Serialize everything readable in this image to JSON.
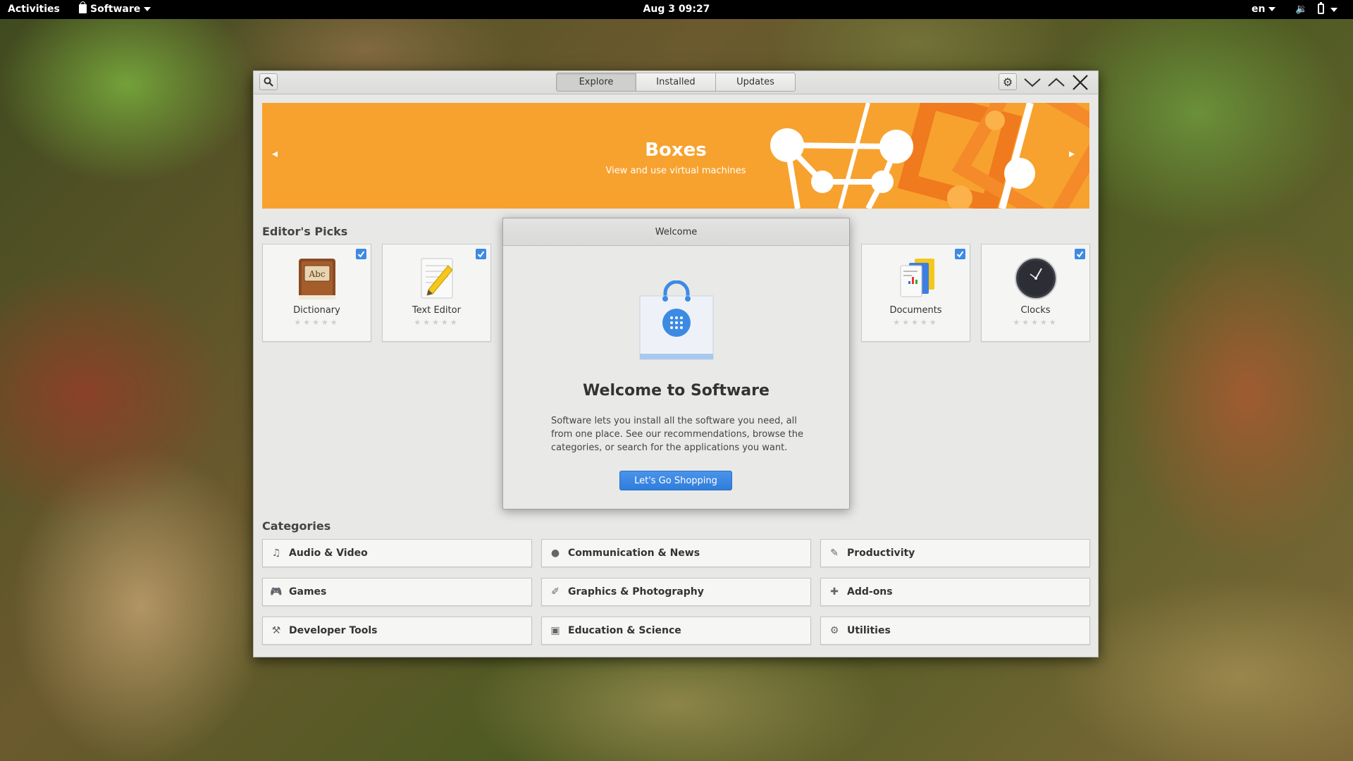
{
  "topbar": {
    "activities": "Activities",
    "app_menu": "Software",
    "clock": "Aug 3  09:27",
    "language": "en",
    "volume_glyph": "🔉"
  },
  "window": {
    "tabs": [
      {
        "label": "Explore",
        "active": true
      },
      {
        "label": "Installed",
        "active": false
      },
      {
        "label": "Updates",
        "active": false
      }
    ],
    "banner": {
      "title": "Boxes",
      "subtitle": "View and use virtual machines",
      "prev_glyph": "◂",
      "next_glyph": "▸",
      "color": "#f7a22e"
    },
    "editors_picks": {
      "title": "Editor's Picks",
      "items": [
        {
          "name": "Dictionary",
          "icon": "dictionary-icon",
          "stars": "★★★★★"
        },
        {
          "name": "Text Editor",
          "icon": "text-editor-icon",
          "stars": "★★★★★"
        },
        {
          "name": "Documents",
          "icon": "documents-icon",
          "stars": "★★★★★"
        },
        {
          "name": "Clocks",
          "icon": "clocks-icon",
          "stars": "★★★★★"
        }
      ]
    },
    "categories": {
      "title": "Categories",
      "items": [
        {
          "label": "Audio & Video",
          "icon": "music-note-icon",
          "glyph": "♫"
        },
        {
          "label": "Communication & News",
          "icon": "chat-bubble-icon",
          "glyph": "●"
        },
        {
          "label": "Productivity",
          "icon": "edit-icon",
          "glyph": "✎"
        },
        {
          "label": "Games",
          "icon": "gamepad-icon",
          "glyph": "🎮"
        },
        {
          "label": "Graphics & Photography",
          "icon": "brush-icon",
          "glyph": "✐"
        },
        {
          "label": "Add-ons",
          "icon": "puzzle-icon",
          "glyph": "✚"
        },
        {
          "label": "Developer Tools",
          "icon": "developer-tools-icon",
          "glyph": "⚒"
        },
        {
          "label": "Education & Science",
          "icon": "education-icon",
          "glyph": "▣"
        },
        {
          "label": "Utilities",
          "icon": "utilities-icon",
          "glyph": "⚙"
        }
      ]
    }
  },
  "dialog": {
    "title": "Welcome",
    "heading": "Welcome to Software",
    "text": "Software lets you install all the software you need, all from one place. See our recommendations, browse the categories, or search for the applications you want.",
    "button": "Let's Go Shopping"
  },
  "colors": {
    "accent": "#3d8ae4",
    "banner": "#f7a22e",
    "topbar": "#000000"
  }
}
